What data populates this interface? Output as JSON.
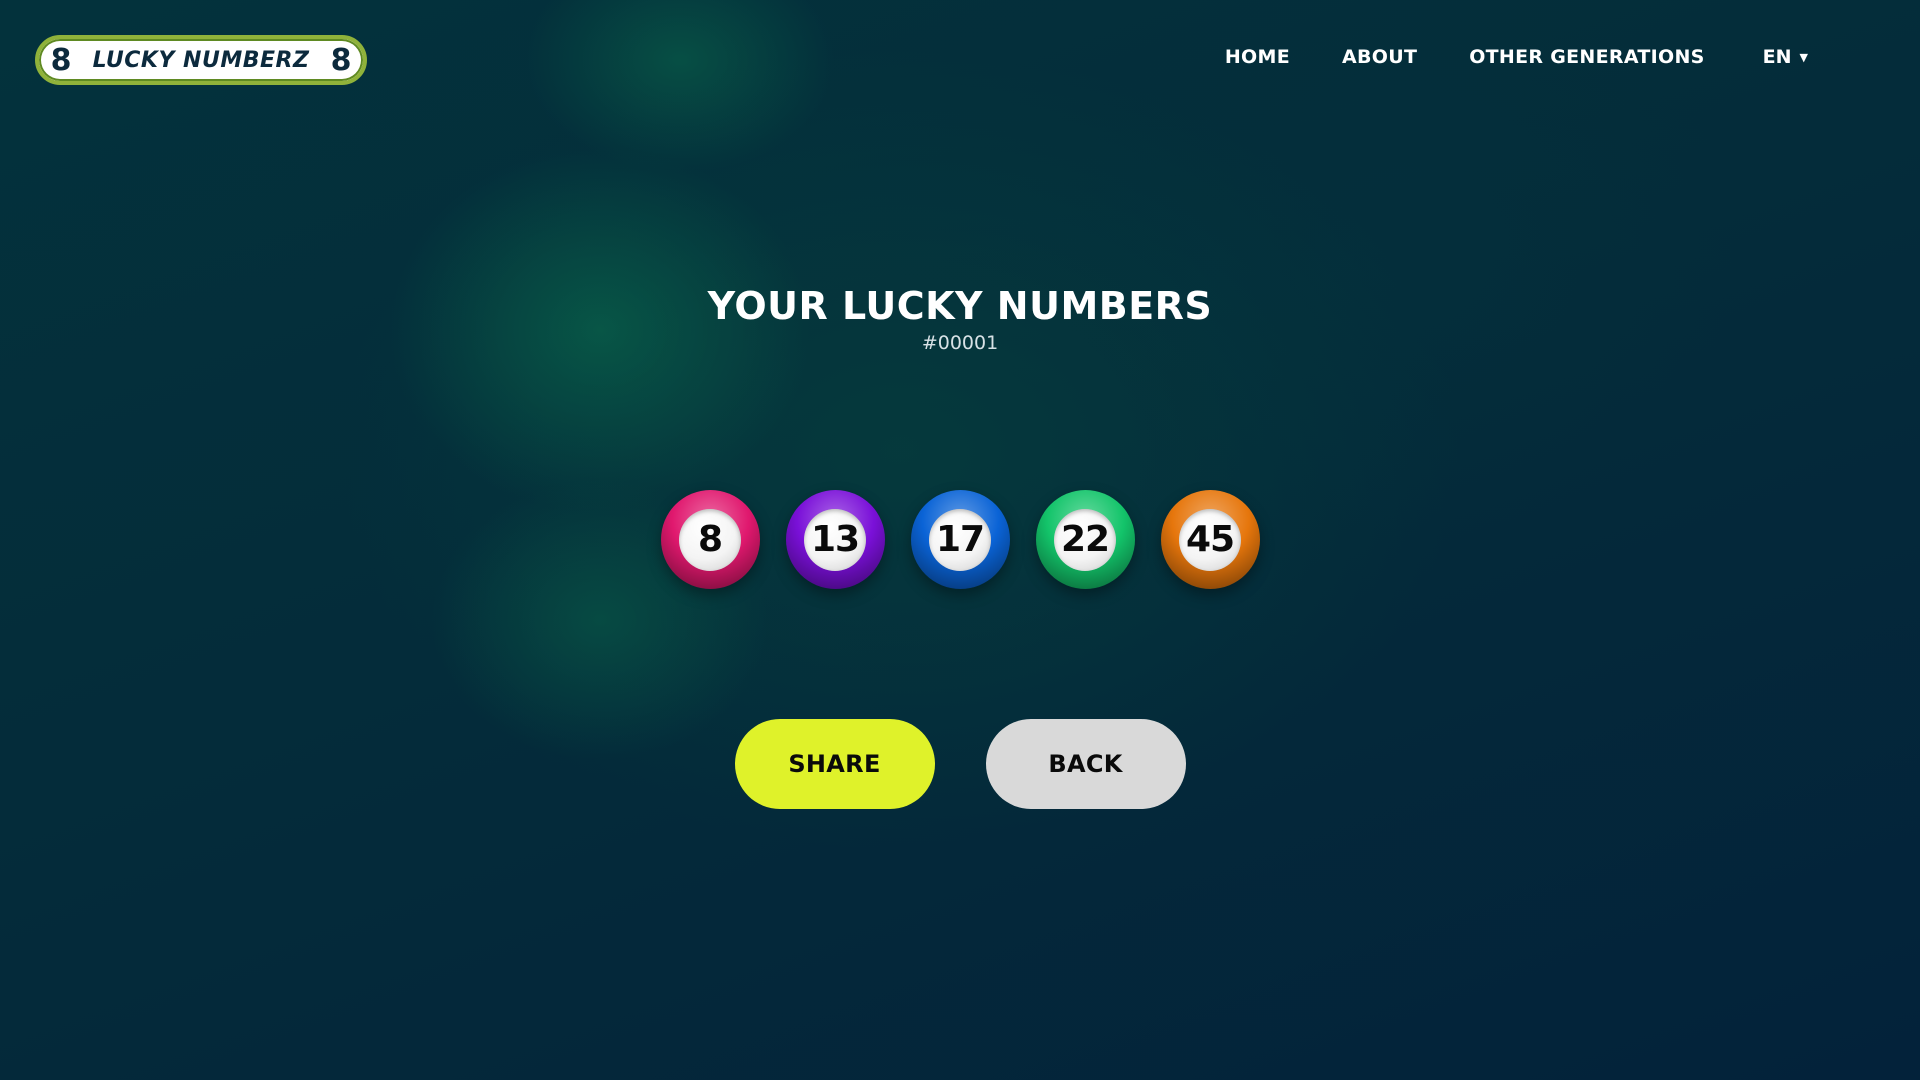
{
  "header": {
    "logo": {
      "text": "LUCKY NUMBERZ",
      "left_mark": "8",
      "right_mark": "8",
      "border_color": "#8fb23a"
    },
    "nav": {
      "items": [
        {
          "label": "HOME"
        },
        {
          "label": "ABOUT"
        },
        {
          "label": "OTHER GENERATIONS"
        }
      ],
      "language": {
        "selected": "EN",
        "icon": "caret-down-icon"
      }
    }
  },
  "main": {
    "title": "YOUR LUCKY NUMBERS",
    "generation_id": "#00001",
    "balls": [
      {
        "number": "8",
        "color": "#e0186e"
      },
      {
        "number": "13",
        "color": "#7a10d8"
      },
      {
        "number": "17",
        "color": "#0a63d6"
      },
      {
        "number": "22",
        "color": "#13c46a"
      },
      {
        "number": "45",
        "color": "#e6760c"
      }
    ],
    "actions": {
      "share_label": "SHARE",
      "back_label": "BACK",
      "share_color": "#dff22a",
      "back_color": "#d9d9d9"
    }
  }
}
